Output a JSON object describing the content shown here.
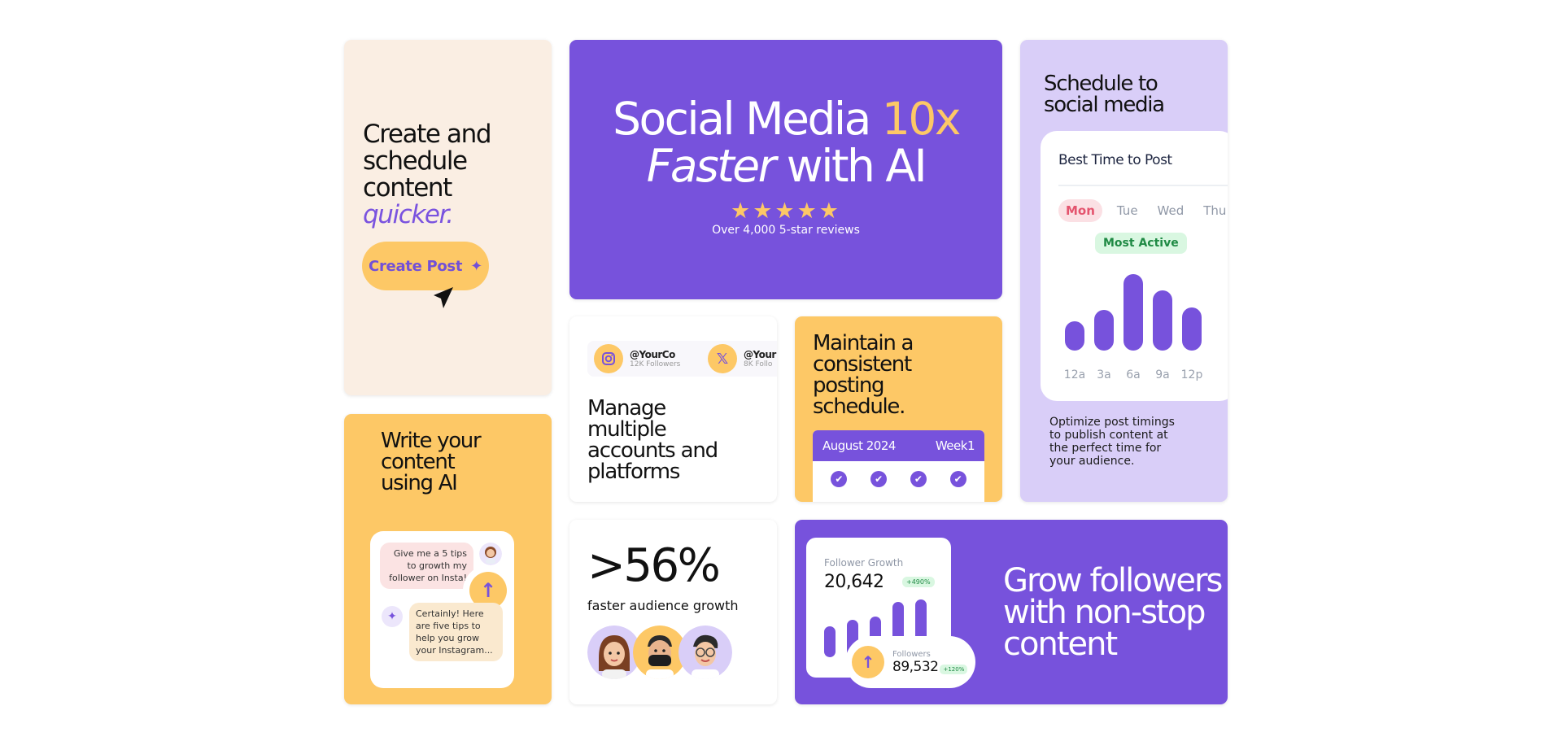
{
  "colors": {
    "purple": "#7752dc",
    "yellow": "#fdc866",
    "cream": "#faeee3",
    "lavender": "#d9cef8"
  },
  "card_create": {
    "head_line1": "Create and",
    "head_line2": "schedule",
    "head_line3": "content",
    "head_accent": "quicker.",
    "button_label": "Create Post",
    "button_icon": "sparkle-icon",
    "cursor_icon": "cursor-arrow-icon"
  },
  "hero": {
    "line1_a": "Social Media ",
    "line1_accent": "10x",
    "line2_italic": "Faster",
    "line2_rest": " with AI",
    "stars": "★★★★★",
    "reviews": "Over 4,000 5-star reviews"
  },
  "schedule": {
    "head_line1": "Schedule to",
    "head_line2": "social media",
    "panel_title": "Best Time to Post",
    "days": [
      "Mon",
      "Tue",
      "Wed",
      "Thu"
    ],
    "selected_day": "Mon",
    "badge": "Most Active",
    "times": [
      "12a",
      "3a",
      "6a",
      "9a",
      "12p"
    ],
    "activity": [
      0.33,
      0.45,
      0.85,
      0.67,
      0.48
    ],
    "desc_line1": "Optimize post timings",
    "desc_line2": "to publish content at",
    "desc_line3": "the perfect time for",
    "desc_line4": "your audience."
  },
  "manage": {
    "accounts": [
      {
        "handle": "@YourCo",
        "followers": "12K Followers",
        "icon": "instagram-icon"
      },
      {
        "handle": "@Your",
        "followers": "8K Follo",
        "icon": "x-logo-icon"
      }
    ],
    "head_line1": "Manage",
    "head_line2": "multiple",
    "head_line3": "accounts and",
    "head_line4": "platforms"
  },
  "maintain": {
    "head_line1": "Maintain a",
    "head_line2": "consistent",
    "head_line3": "posting",
    "head_line4": "schedule.",
    "month": "August 2024",
    "week": "Week1",
    "check_icon": "check-icon"
  },
  "write": {
    "head_line1": "Write your",
    "head_line2": "content",
    "head_line3": "using AI",
    "prompt_l1": "Give me a 5 tips",
    "prompt_l2": "to growth my",
    "prompt_l3": "follower on Insta!",
    "reply_l1": "Certainly! Here",
    "reply_l2": "are five tips to",
    "reply_l3": "help you grow",
    "reply_l4": "your Instagram...",
    "send_icon": "arrow-up-icon",
    "ai_icon": "sparkle-icon"
  },
  "growth_stat": {
    "value": ">56%",
    "label": "faster audience growth"
  },
  "grow": {
    "chart_label": "Follower Growth",
    "chart_value": "20,642",
    "chart_badge": "+490%",
    "bars": [
      0.47,
      0.58,
      0.62,
      0.85,
      0.89
    ],
    "followers_label": "Followers",
    "followers_value": "89,532",
    "followers_badge": "+120%",
    "head_line1": "Grow followers",
    "head_line2": "with non-stop",
    "head_line3": "content"
  }
}
